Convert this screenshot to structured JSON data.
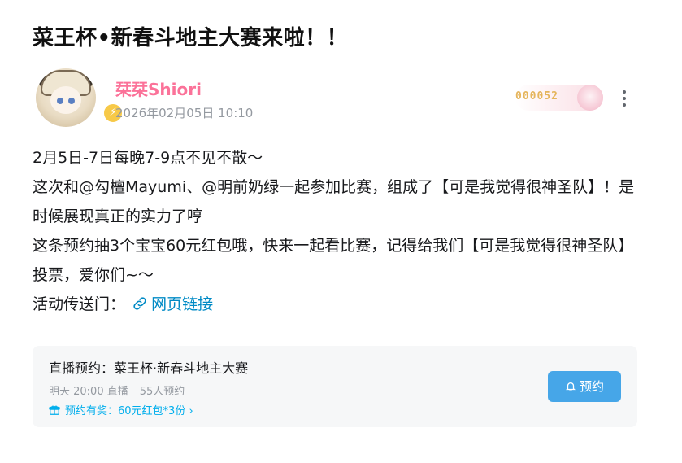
{
  "post": {
    "title": "菜王杯•新春斗地主大赛来啦！！"
  },
  "author": {
    "name": "栞栞Shiori",
    "time": "2026年02月05日 10:10",
    "badge_icon": "lightning-icon",
    "fan_badge_number": "000052"
  },
  "content": {
    "line1": "2月5日-7日每晚7-9点不见不散～",
    "line2": "这次和@勾檀Mayumi、@明前奶绿一起参加比赛，组成了【可是我觉得很神圣队】！是时候展现真正的实力了哼",
    "line3": "这条预约抽3个宝宝60元红包哦，快来一起看比赛，记得给我们【可是我觉得很神圣队】投票，爱你们~～",
    "portal_label": "活动传送门：",
    "link_text": "网页链接"
  },
  "reservation": {
    "title": "直播预约：菜王杯·新春斗地主大赛",
    "time": "明天 20:00 直播",
    "count": "55人预约",
    "reward": "预约有奖：60元红包*3份",
    "button": "预约"
  },
  "colors": {
    "username": "#fb7299",
    "link": "#008ac5",
    "button": "#46a6e8",
    "reward": "#00aeec"
  }
}
